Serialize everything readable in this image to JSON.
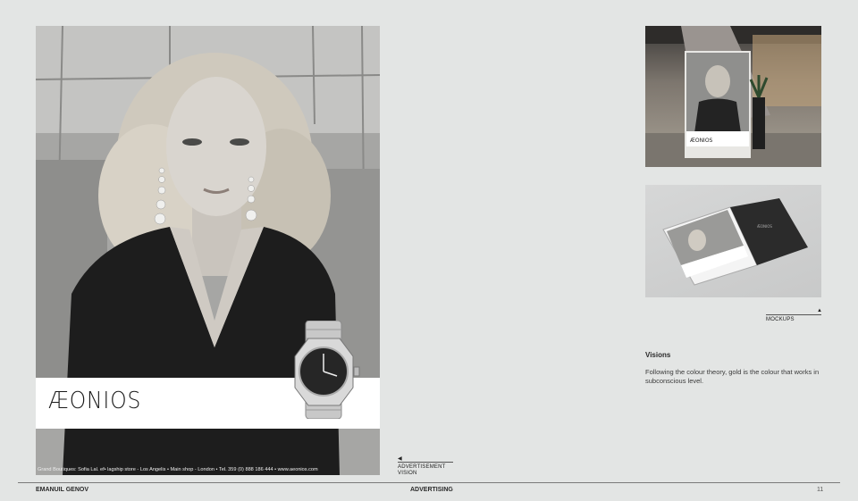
{
  "ad": {
    "brand_logo": "ÆONIOS",
    "footer_line": "Grand Boutiques: Sofia Lal. ef• lagship store - Los Angelis • Main shop - London • Tel. 359 (0) 888 186 444 • www.aeonios.com"
  },
  "captions": {
    "ad_caption_line1": "ADVERTISEMENT",
    "ad_caption_line2": "VISION",
    "mockups": "MOCKUPS"
  },
  "visions": {
    "title": "Visions",
    "body": "Following the colour theory, gold is the colour that works in subconscious level."
  },
  "footer": {
    "author": "EMANUIL GENOV",
    "section": "ADVERTISING",
    "page_number": "11"
  },
  "mockup_1": {
    "poster_logo": "ÆONIOS"
  },
  "mockup_2": {
    "magazine_logo": "ÆONIOS"
  }
}
